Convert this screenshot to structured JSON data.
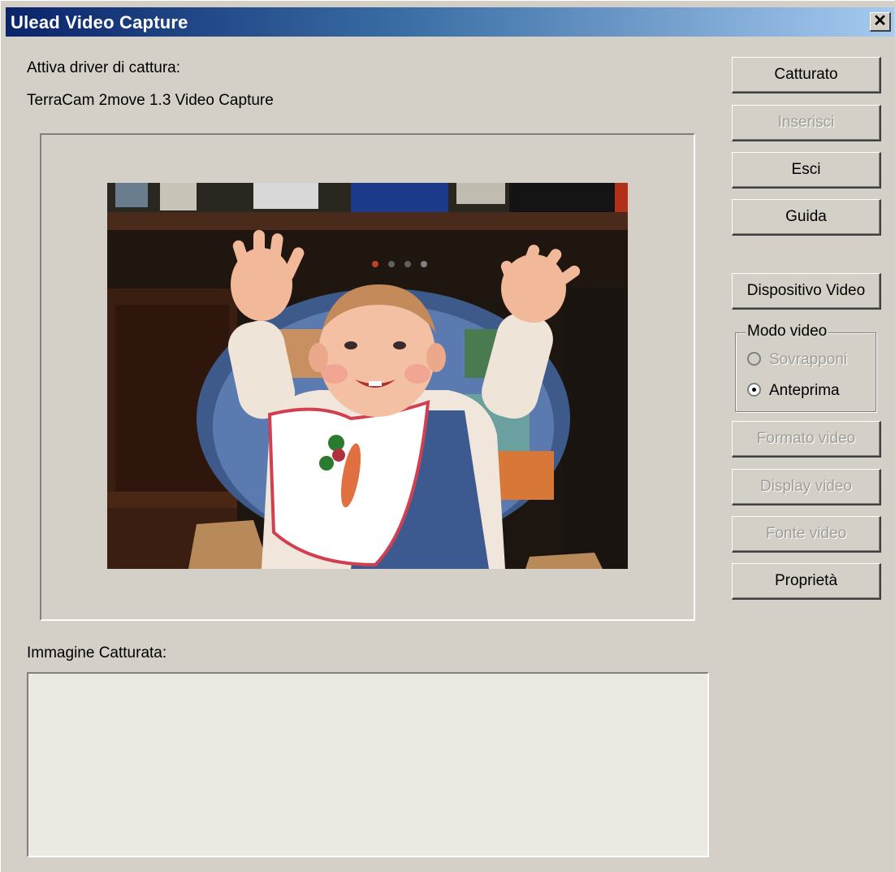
{
  "window": {
    "title": "Ulead Video Capture",
    "close_symbol": "✕"
  },
  "driver": {
    "label": "Attiva driver di cattura:",
    "device": "TerraCam 2move 1.3 Video Capture"
  },
  "captured": {
    "label": "Immagine Catturata:"
  },
  "buttons": {
    "capture": "Catturato",
    "insert": "Inserisci",
    "exit": "Esci",
    "help": "Guida",
    "video_device": "Dispositivo Video",
    "video_format": "Formato video",
    "video_display": "Display video",
    "video_source": "Fonte video",
    "properties": "Proprietà"
  },
  "video_mode": {
    "legend": "Modo video",
    "options": [
      {
        "label": "Sovrapponi",
        "selected": false,
        "enabled": false
      },
      {
        "label": "Anteprima",
        "selected": true,
        "enabled": true
      }
    ]
  },
  "colors": {
    "dialog_bg": "#d4d0c8",
    "title_gradient_start": "#0a246a",
    "title_gradient_end": "#a6caf0",
    "captured_area_bg": "#ece9e2"
  }
}
